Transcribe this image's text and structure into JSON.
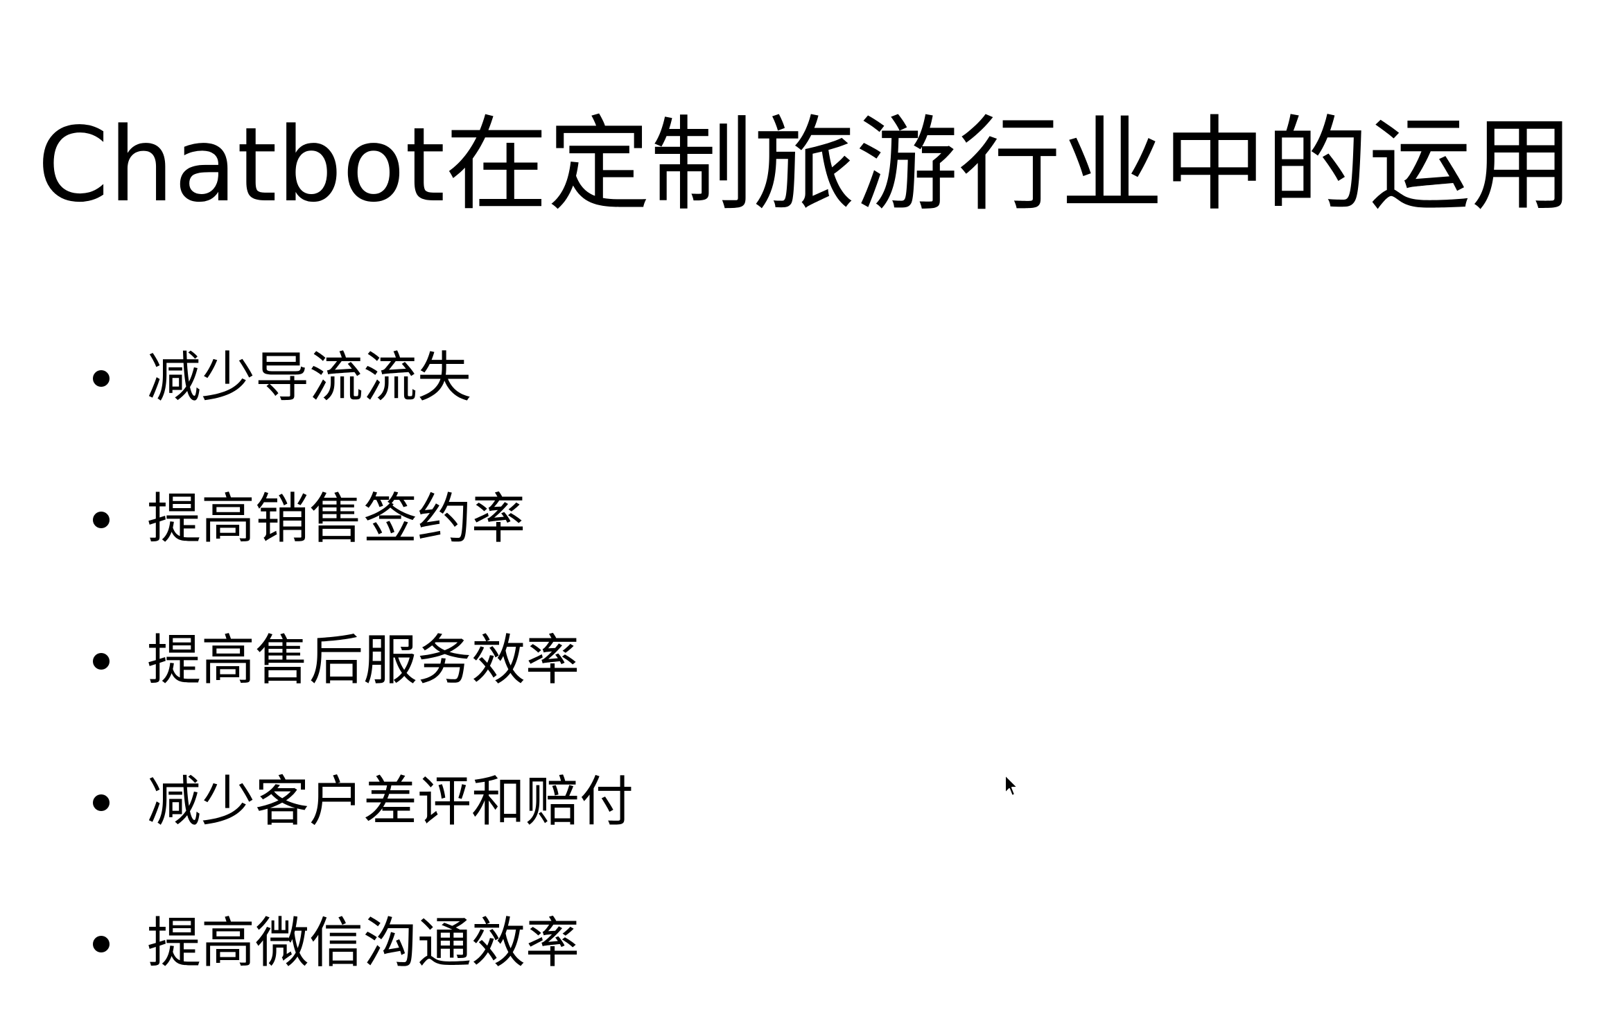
{
  "slide": {
    "title": "Chatbot在定制旅游行业中的运用",
    "bullets": [
      "减少导流流失",
      "提高销售签约率",
      "提高售后服务效率",
      "减少客户差评和赔付",
      "提高微信沟通效率"
    ]
  },
  "icons": {
    "bullet": "bullet-dot-icon",
    "cursor": "mouse-cursor-icon"
  },
  "colors": {
    "background": "#ffffff",
    "text": "#000000"
  }
}
